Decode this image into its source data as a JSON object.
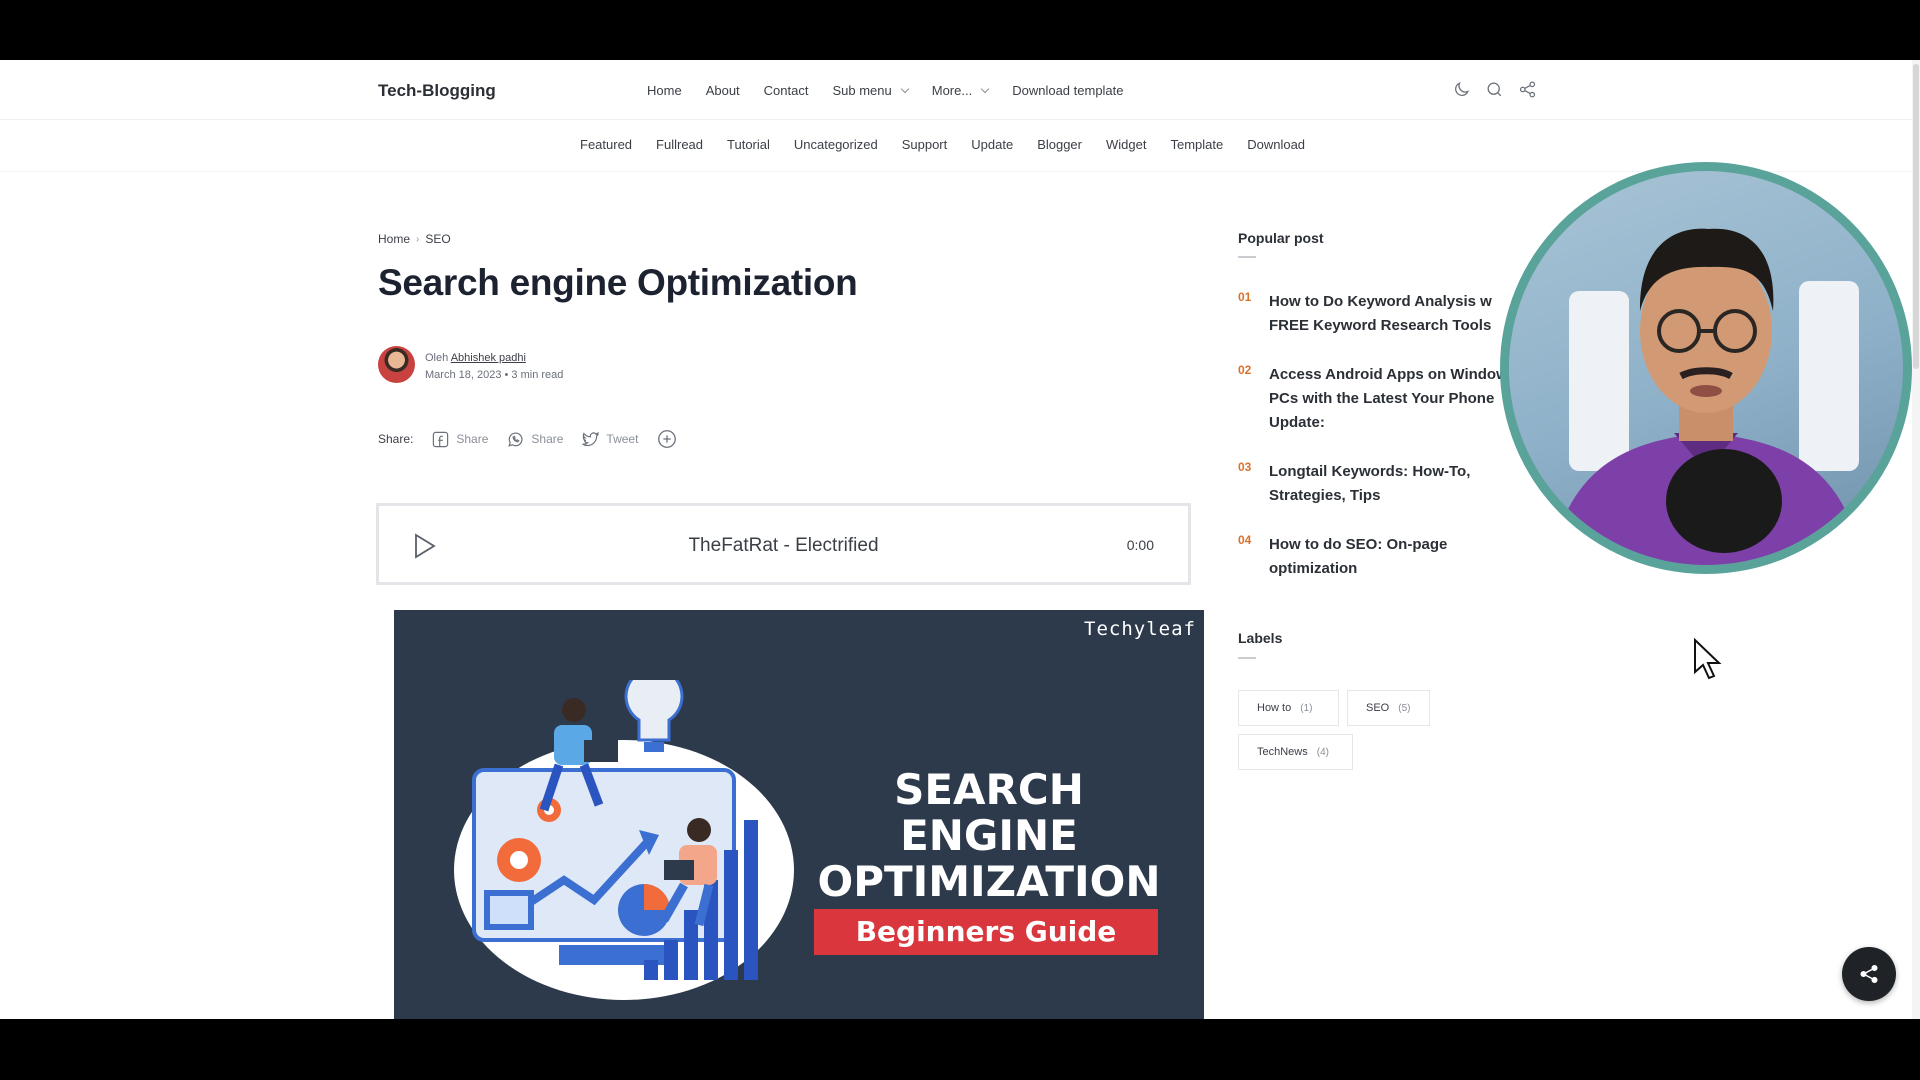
{
  "site": {
    "brand": "Tech-Blogging"
  },
  "main_nav": [
    {
      "label": "Home"
    },
    {
      "label": "About"
    },
    {
      "label": "Contact"
    },
    {
      "label": "Sub menu",
      "dropdown": true
    },
    {
      "label": "More...",
      "dropdown": true
    },
    {
      "label": "Download template"
    }
  ],
  "header_icons": [
    "dark-mode-moon-icon",
    "search-icon",
    "share-icon"
  ],
  "categories": [
    "Featured",
    "Fullread",
    "Tutorial",
    "Uncategorized",
    "Support",
    "Update",
    "Blogger",
    "Widget",
    "Template",
    "Download"
  ],
  "breadcrumb": {
    "home": "Home",
    "separator": "›",
    "current": "SEO"
  },
  "post": {
    "title": "Search engine Optimization",
    "author_prefix": "Oleh",
    "author": "Abhishek padhi",
    "date": "March 18, 2023",
    "dot": "•",
    "read_time": "3 min read"
  },
  "share": {
    "label": "Share:",
    "facebook": "Share",
    "whatsapp": "Share",
    "twitter": "Tweet"
  },
  "player": {
    "track": "TheFatRat - Electrified",
    "time": "0:00"
  },
  "hero": {
    "watermark": "Techyleaf",
    "line1": "SEARCH",
    "line2": "ENGINE",
    "line3": "OPTIMIZATION",
    "tagline": "Beginners Guide",
    "colors": {
      "background": "#2d3a4b",
      "tagline_bg": "#d9363e"
    }
  },
  "sidebar": {
    "popular_heading": "Popular post",
    "popular": [
      {
        "num": "01",
        "title": "How to Do Keyword Analysis w FREE Keyword Research Tools"
      },
      {
        "num": "02",
        "title": "Access Android Apps on Window PCs with the Latest Your Phone Update:"
      },
      {
        "num": "03",
        "title": "Longtail Keywords: How-To, Strategies, Tips"
      },
      {
        "num": "04",
        "title": "How to do SEO: On-page optimization"
      }
    ],
    "labels_heading": "Labels",
    "labels": [
      {
        "name": "How to",
        "count": "(1)"
      },
      {
        "name": "SEO",
        "count": "(5)"
      },
      {
        "name": "TechNews",
        "count": "(4)"
      }
    ]
  },
  "colors": {
    "accent_number": "#d9722b",
    "webcam_ring": "#5aa39a"
  }
}
